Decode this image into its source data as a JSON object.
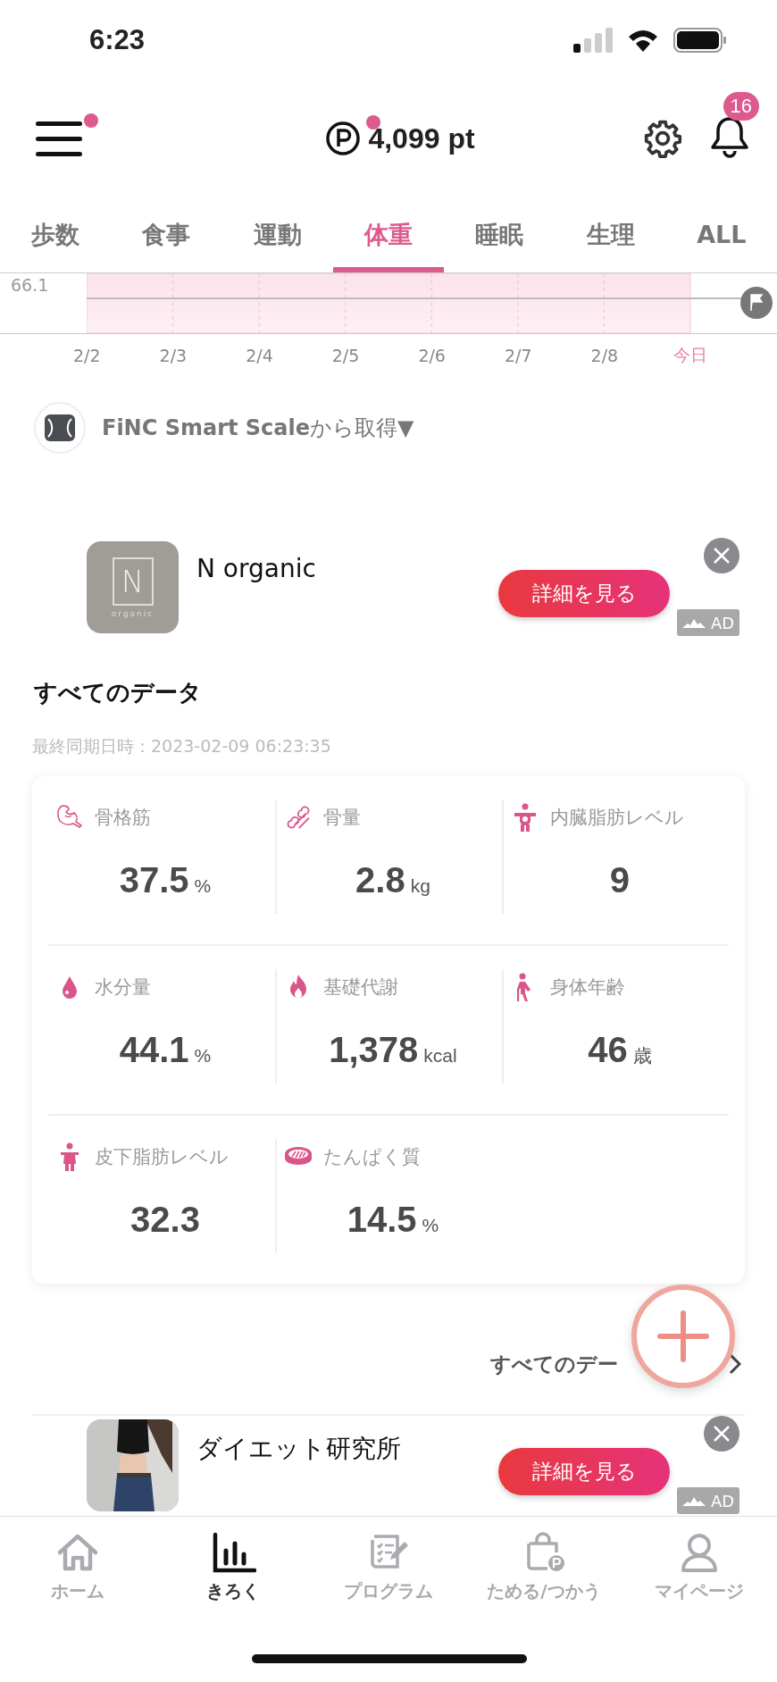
{
  "status_bar": {
    "time": "6:23"
  },
  "header": {
    "menu": {
      "has_notification": true
    },
    "points": {
      "value": "4,099 pt",
      "has_notification": true
    },
    "notifications": {
      "count": "16"
    }
  },
  "tabs": [
    {
      "label": "歩数",
      "selected": false
    },
    {
      "label": "食事",
      "selected": false
    },
    {
      "label": "運動",
      "selected": false
    },
    {
      "label": "体重",
      "selected": true
    },
    {
      "label": "睡眠",
      "selected": false
    },
    {
      "label": "生理",
      "selected": false
    },
    {
      "label": "ALL",
      "selected": false
    }
  ],
  "chart": {
    "y_label": "66.1",
    "x_labels": [
      {
        "label": "2/2",
        "today": false
      },
      {
        "label": "2/3",
        "today": false
      },
      {
        "label": "2/4",
        "today": false
      },
      {
        "label": "2/5",
        "today": false
      },
      {
        "label": "2/6",
        "today": false
      },
      {
        "label": "2/7",
        "today": false
      },
      {
        "label": "2/8",
        "today": false
      },
      {
        "label": "今日",
        "today": true
      }
    ]
  },
  "source": {
    "text": "**FiNC Smart Scale**から取得▼"
  },
  "ad_top": {
    "title": "N organic",
    "logo": {
      "mark": "N",
      "sub": "organic"
    },
    "button": "詳細を見る",
    "badge": "AD"
  },
  "all_data": {
    "title": "すべてのデータ",
    "synced": "最終同期日時：2023-02-09 06:23:35",
    "metrics": [
      {
        "label": "骨格筋",
        "value": "37.5",
        "unit": "%"
      },
      {
        "label": "骨量",
        "value": "2.8",
        "unit": "kg"
      },
      {
        "label": "内臓脂肪レベル",
        "value": "9"
      },
      {
        "label": "水分量",
        "value": "44.1",
        "unit": "%"
      },
      {
        "label": "基礎代謝",
        "value": "1,378",
        "unit": "kcal"
      },
      {
        "label": "身体年齢",
        "value": "46",
        "unit": "歳"
      },
      {
        "label": "皮下脂肪レベル",
        "value": "32.3"
      },
      {
        "label": "たんぱく質",
        "value": "14.5",
        "unit": "%"
      }
    ]
  },
  "all_data_link": {
    "label": "すべてのデー"
  },
  "ad_bottom": {
    "title": "ダイエット研究所",
    "button": "詳細を見る",
    "badge": "AD"
  },
  "bottom_nav": [
    {
      "label": "ホーム",
      "selected": false
    },
    {
      "label": "きろく",
      "selected": true
    },
    {
      "label": "プログラム",
      "selected": false
    },
    {
      "label": "ためる/つかう",
      "selected": false
    },
    {
      "label": "マイページ",
      "selected": false
    }
  ]
}
